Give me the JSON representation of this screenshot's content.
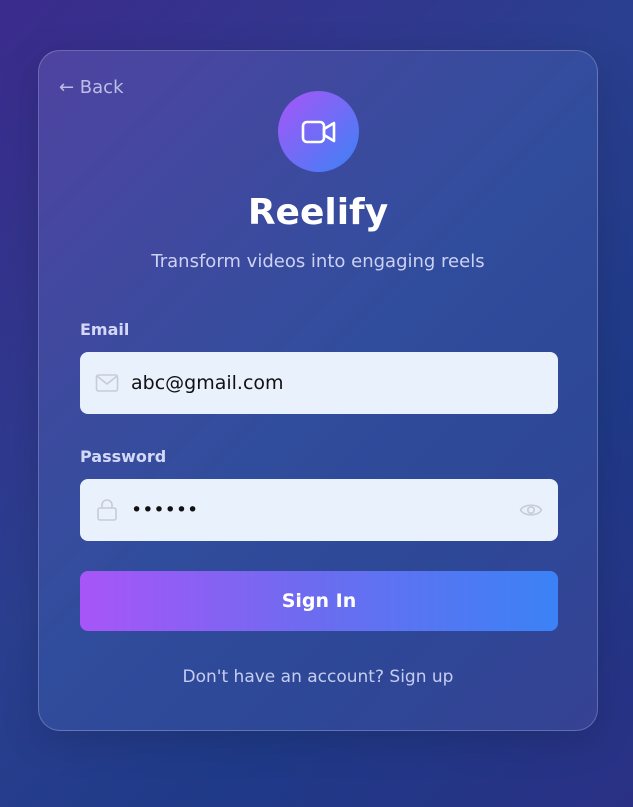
{
  "nav": {
    "back_label": "← Back"
  },
  "brand": {
    "name": "Reelify",
    "tagline": "Transform videos into engaging reels",
    "logo_icon": "video-camera-icon"
  },
  "form": {
    "email_label": "Email",
    "email_value": "abc@gmail.com",
    "email_icon": "mail-icon",
    "password_label": "Password",
    "password_value": "••••••",
    "password_icon": "lock-icon",
    "toggle_icon": "eye-icon",
    "submit_label": "Sign In"
  },
  "footer": {
    "prompt": "Don't have an account? ",
    "signup_link": "Sign up"
  },
  "colors": {
    "accent_start": "#a855f7",
    "accent_end": "#3b82f6",
    "field_bg": "#e9f1fd"
  }
}
